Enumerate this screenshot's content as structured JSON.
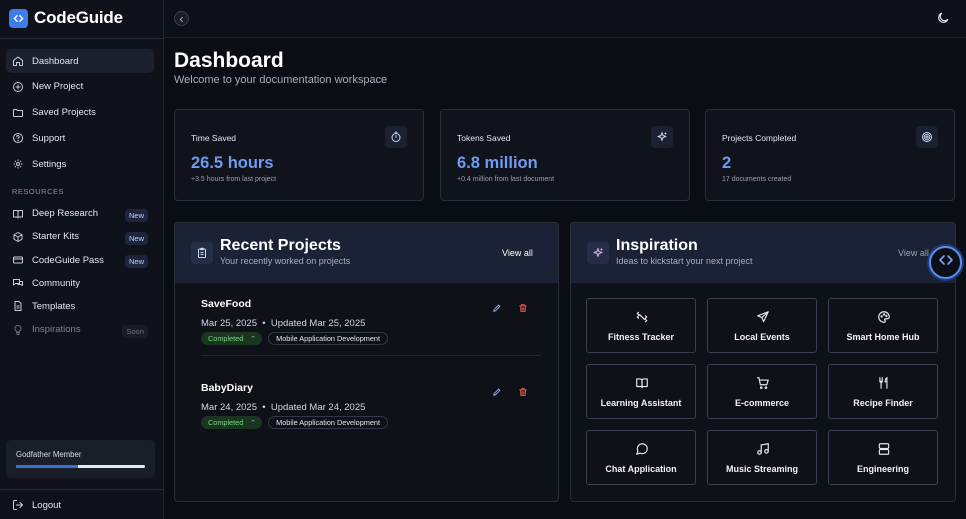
{
  "app": {
    "name": "CodeGuide"
  },
  "sidebar": {
    "main_items": [
      {
        "label": "Dashboard",
        "icon": "home-icon"
      },
      {
        "label": "New Project",
        "icon": "plus-circle-icon"
      },
      {
        "label": "Saved Projects",
        "icon": "folder-icon"
      },
      {
        "label": "Support",
        "icon": "help-circle-icon"
      },
      {
        "label": "Settings",
        "icon": "gear-icon"
      }
    ],
    "resources_label": "RESOURCES",
    "resource_items": [
      {
        "label": "Deep Research",
        "icon": "book-icon",
        "badge": "New"
      },
      {
        "label": "Starter Kits",
        "icon": "package-icon",
        "badge": "New"
      },
      {
        "label": "CodeGuide Pass",
        "icon": "card-icon",
        "badge": "New"
      },
      {
        "label": "Community",
        "icon": "chat-icon",
        "badge": ""
      },
      {
        "label": "Templates",
        "icon": "document-icon",
        "badge": ""
      },
      {
        "label": "Inspirations",
        "icon": "lightbulb-icon",
        "badge": "Soon"
      }
    ],
    "member": {
      "label": "Godfather Member",
      "progress": 0.48
    },
    "logout_label": "Logout"
  },
  "page": {
    "title": "Dashboard",
    "subtitle": "Welcome to your documentation workspace"
  },
  "stats": [
    {
      "label": "Time Saved",
      "value": "26.5 hours",
      "sub": "+3.5 hours from last project",
      "icon": "stopwatch-icon"
    },
    {
      "label": "Tokens Saved",
      "value": "6.8 million",
      "sub": "+0.4 million from last document",
      "icon": "sparkle-icon"
    },
    {
      "label": "Projects Completed",
      "value": "2",
      "sub": "17 documents created",
      "icon": "target-icon"
    }
  ],
  "recent": {
    "title": "Recent Projects",
    "subtitle": "Your recently worked on projects",
    "view_all": "View all",
    "projects": [
      {
        "name": "SaveFood",
        "created": "Mar 25, 2025",
        "separator": "•",
        "updated": "Updated Mar 25, 2025",
        "status": "Completed",
        "category": "Mobile Application Development"
      },
      {
        "name": "BabyDiary",
        "created": "Mar 24, 2025",
        "separator": "•",
        "updated": "Updated Mar 24, 2025",
        "status": "Completed",
        "category": "Mobile Application Development"
      }
    ]
  },
  "inspiration": {
    "title": "Inspiration",
    "subtitle": "Ideas to kickstart your next project",
    "view_all": "View all",
    "tiles": [
      {
        "label": "Fitness Tracker",
        "icon": "dumbbell-icon"
      },
      {
        "label": "Local Events",
        "icon": "plane-icon"
      },
      {
        "label": "Smart Home Hub",
        "icon": "palette-icon"
      },
      {
        "label": "Learning Assistant",
        "icon": "open-book-icon"
      },
      {
        "label": "E-commerce",
        "icon": "cart-icon"
      },
      {
        "label": "Recipe Finder",
        "icon": "utensils-icon"
      },
      {
        "label": "Chat Application",
        "icon": "message-circle-icon"
      },
      {
        "label": "Music Streaming",
        "icon": "music-icon"
      },
      {
        "label": "Engineering",
        "icon": "server-icon"
      }
    ]
  },
  "colors": {
    "accent": "#6f9bf0",
    "brand": "#3d7fe6",
    "status_green": "#7ed58a",
    "delete_red": "#e0564f"
  }
}
